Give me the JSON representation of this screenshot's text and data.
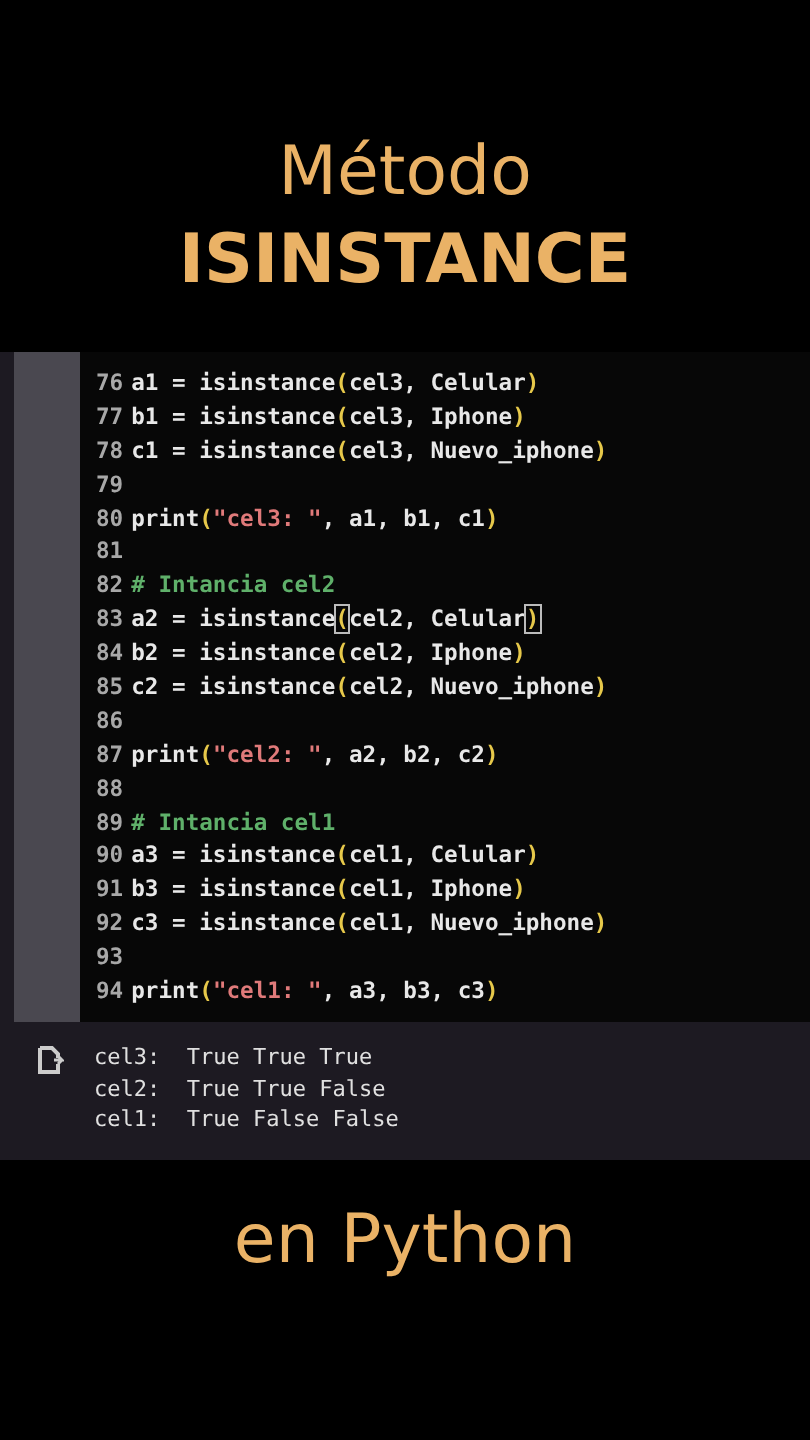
{
  "title": {
    "line1": "Método",
    "line2": "ISINSTANCE"
  },
  "code_lines": [
    {
      "number": "76",
      "tokens": [
        {
          "kind": "plain",
          "text": "a1 = isinstance"
        },
        {
          "kind": "paren",
          "text": "("
        },
        {
          "kind": "plain",
          "text": "cel3, Celular"
        },
        {
          "kind": "paren",
          "text": ")"
        }
      ]
    },
    {
      "number": "77",
      "tokens": [
        {
          "kind": "plain",
          "text": "b1 = isinstance"
        },
        {
          "kind": "paren",
          "text": "("
        },
        {
          "kind": "plain",
          "text": "cel3, Iphone"
        },
        {
          "kind": "paren",
          "text": ")"
        }
      ]
    },
    {
      "number": "78",
      "tokens": [
        {
          "kind": "plain",
          "text": "c1 = isinstance"
        },
        {
          "kind": "paren",
          "text": "("
        },
        {
          "kind": "plain",
          "text": "cel3, Nuevo_iphone"
        },
        {
          "kind": "paren",
          "text": ")"
        }
      ]
    },
    {
      "number": "79"
    },
    {
      "number": "80",
      "tokens": [
        {
          "kind": "plain",
          "text": "print"
        },
        {
          "kind": "paren",
          "text": "("
        },
        {
          "kind": "string",
          "text": "\"cel3: \""
        },
        {
          "kind": "plain",
          "text": ", a1, b1, c1"
        },
        {
          "kind": "paren",
          "text": ")"
        }
      ]
    },
    {
      "number": "81"
    },
    {
      "number": "82",
      "tokens": [
        {
          "kind": "comment",
          "text": "# Intancia cel2"
        }
      ]
    },
    {
      "number": "83",
      "tokens": [
        {
          "kind": "plain",
          "text": "a2 = isinstance"
        },
        {
          "kind": "match",
          "text": "("
        },
        {
          "kind": "plain",
          "text": "cel2, Celular"
        },
        {
          "kind": "match",
          "text": ")"
        }
      ]
    },
    {
      "number": "84",
      "tokens": [
        {
          "kind": "plain",
          "text": "b2 = isinstance"
        },
        {
          "kind": "paren",
          "text": "("
        },
        {
          "kind": "plain",
          "text": "cel2, Iphone"
        },
        {
          "kind": "paren",
          "text": ")"
        }
      ]
    },
    {
      "number": "85",
      "tokens": [
        {
          "kind": "plain",
          "text": "c2 = isinstance"
        },
        {
          "kind": "paren",
          "text": "("
        },
        {
          "kind": "plain",
          "text": "cel2, Nuevo_iphone"
        },
        {
          "kind": "paren",
          "text": ")"
        }
      ]
    },
    {
      "number": "86"
    },
    {
      "number": "87",
      "tokens": [
        {
          "kind": "plain",
          "text": "print"
        },
        {
          "kind": "paren",
          "text": "("
        },
        {
          "kind": "string",
          "text": "\"cel2: \""
        },
        {
          "kind": "plain",
          "text": ", a2, b2, c2"
        },
        {
          "kind": "paren",
          "text": ")"
        }
      ]
    },
    {
      "number": "88"
    },
    {
      "number": "89",
      "tokens": [
        {
          "kind": "comment",
          "text": "# Intancia cel1"
        }
      ]
    },
    {
      "number": "90",
      "tokens": [
        {
          "kind": "plain",
          "text": "a3 = isinstance"
        },
        {
          "kind": "paren",
          "text": "("
        },
        {
          "kind": "plain",
          "text": "cel1, Celular"
        },
        {
          "kind": "paren",
          "text": ")"
        }
      ]
    },
    {
      "number": "91",
      "tokens": [
        {
          "kind": "plain",
          "text": "b3 = isinstance"
        },
        {
          "kind": "paren",
          "text": "("
        },
        {
          "kind": "plain",
          "text": "cel1, Iphone"
        },
        {
          "kind": "paren",
          "text": ")"
        }
      ]
    },
    {
      "number": "92",
      "tokens": [
        {
          "kind": "plain",
          "text": "c3 = isinstance"
        },
        {
          "kind": "paren",
          "text": "("
        },
        {
          "kind": "plain",
          "text": "cel1, Nuevo_iphone"
        },
        {
          "kind": "paren",
          "text": ")"
        }
      ]
    },
    {
      "number": "93"
    },
    {
      "number": "94",
      "tokens": [
        {
          "kind": "plain",
          "text": "print"
        },
        {
          "kind": "paren",
          "text": "("
        },
        {
          "kind": "string",
          "text": "\"cel1: \""
        },
        {
          "kind": "plain",
          "text": ", a3, b3, c3"
        },
        {
          "kind": "paren",
          "text": ")"
        }
      ]
    }
  ],
  "output_lines": [
    "cel3:  True True True",
    "cel2:  True True False",
    "cel1:  True False False"
  ],
  "subtitle": "en Python"
}
